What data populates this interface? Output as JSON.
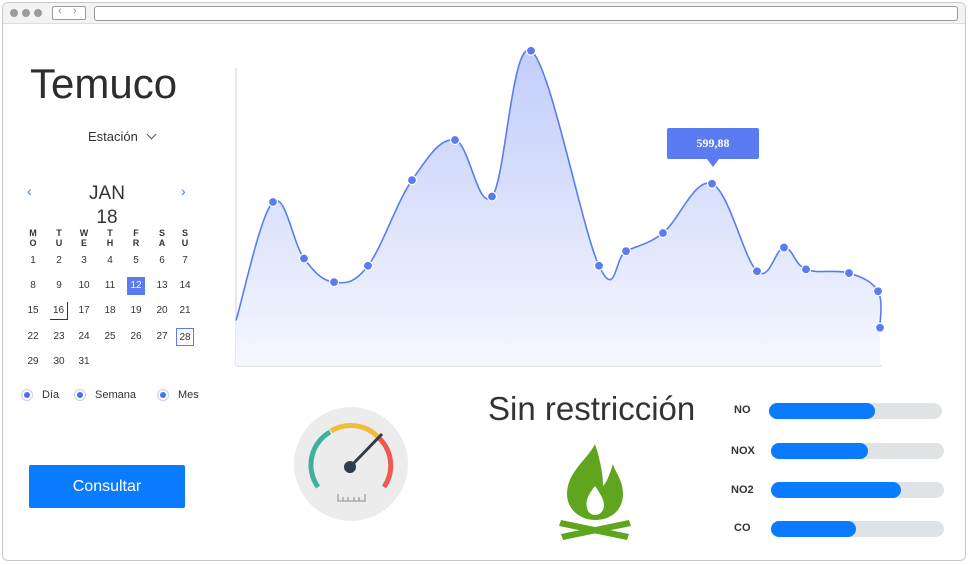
{
  "city": "Temuco",
  "station_select": {
    "label": "Estación",
    "icon": "chevron-down-icon"
  },
  "calendar": {
    "prev_icon": "‹",
    "next_icon": "›",
    "month": "JAN",
    "year": "18",
    "weekdays": [
      "MO",
      "TU",
      "WE",
      "TH",
      "FR",
      "SA",
      "SU"
    ],
    "days": [
      [
        1,
        2,
        3,
        4,
        5,
        6,
        7
      ],
      [
        8,
        9,
        10,
        11,
        12,
        13,
        14
      ],
      [
        15,
        16,
        17,
        18,
        19,
        20,
        21
      ],
      [
        22,
        23,
        24,
        25,
        26,
        27,
        28
      ],
      [
        29,
        30,
        31
      ]
    ],
    "selected_day": 12,
    "marked_day": 16,
    "boxed_day": 28
  },
  "period_options": [
    {
      "label": "Día"
    },
    {
      "label": "Semana"
    },
    {
      "label": "Mes"
    }
  ],
  "consult_button": "Consultar",
  "chart_data": {
    "type": "area",
    "values": [
      0,
      65,
      34,
      21,
      30,
      77,
      99,
      68,
      148,
      30,
      38,
      48,
      75,
      27,
      40,
      28,
      26,
      16,
      -4
    ],
    "ylim": [
      -25,
      155
    ],
    "tooltip": "599,88",
    "tooltip_index": 12,
    "accent": "#5b7cf0"
  },
  "restriction_status": "Sin restricción",
  "pollutants": [
    {
      "name": "NO",
      "fraction": 0.61
    },
    {
      "name": "NOX",
      "fraction": 0.56
    },
    {
      "name": "NO2",
      "fraction": 0.75
    },
    {
      "name": "CO",
      "fraction": 0.49
    }
  ],
  "colors": {
    "primary": "#0a7bff",
    "chart": "#5b7cf0",
    "fire_green": "#5fa51d",
    "track": "#e0e3e6"
  }
}
